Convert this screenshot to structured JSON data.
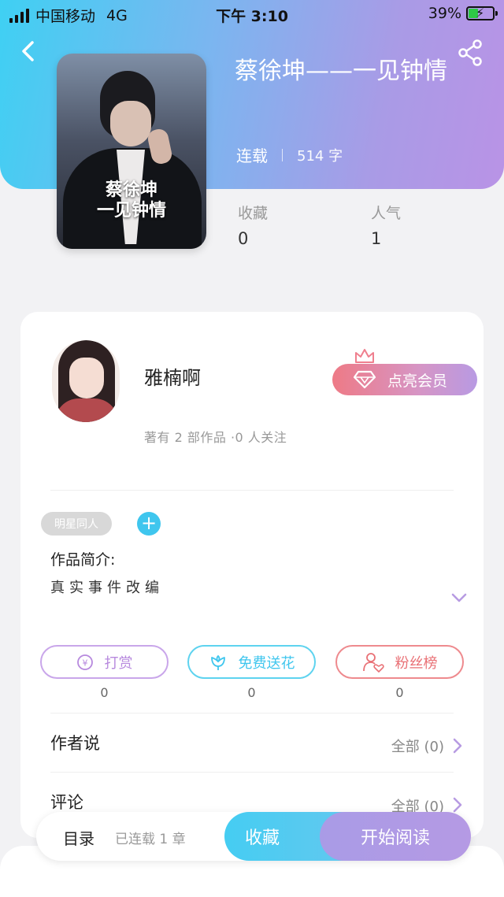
{
  "status_bar": {
    "carrier": "中国移动",
    "network": "4G",
    "time": "下午 3:10",
    "battery": "39%",
    "battery_level": 0.39
  },
  "book": {
    "title": "蔡徐坤——一见钟情",
    "status": "连载",
    "word_count": "514 字",
    "cover_text_line1": "蔡徐坤",
    "cover_text_line2": "一见钟情"
  },
  "stats": {
    "favorites_label": "收藏",
    "favorites_value": "0",
    "popularity_label": "人气",
    "popularity_value": "1"
  },
  "author": {
    "name": "雅楠啊",
    "info": "著有 2 部作品 ·0 人关注",
    "vip_label": "点亮会员"
  },
  "tags": {
    "items": [
      "明星同人"
    ],
    "add_label": "+"
  },
  "intro": {
    "label": "作品简介:",
    "text": "真实事件改编"
  },
  "actions": {
    "tip_label": "打赏",
    "tip_count": "0",
    "flower_label": "免费送花",
    "flower_count": "0",
    "fans_label": "粉丝榜",
    "fans_count": "0"
  },
  "sections": {
    "author_says_label": "作者说",
    "author_says_all": "全部 (0)",
    "comments_label": "评论",
    "comments_all": "全部 (0)"
  },
  "bottom_bar": {
    "toc_label": "目录",
    "toc_status": "已连载 1 章",
    "favorite_label": "收藏",
    "read_label": "开始阅读"
  },
  "colors": {
    "header_start": "#3fd0f3",
    "header_end": "#b993e6",
    "accent_blue": "#3fc6ee",
    "accent_purple": "#b789de",
    "accent_red": "#e97176"
  },
  "icons": {
    "back": "chevron-left-icon",
    "share": "share-icon",
    "crown": "crown-icon",
    "diamond": "diamond-icon",
    "yen": "yen-coin-icon",
    "flower": "flower-icon",
    "fans": "user-heart-icon",
    "expand": "chevron-down-icon",
    "row": "chevron-right-icon"
  }
}
